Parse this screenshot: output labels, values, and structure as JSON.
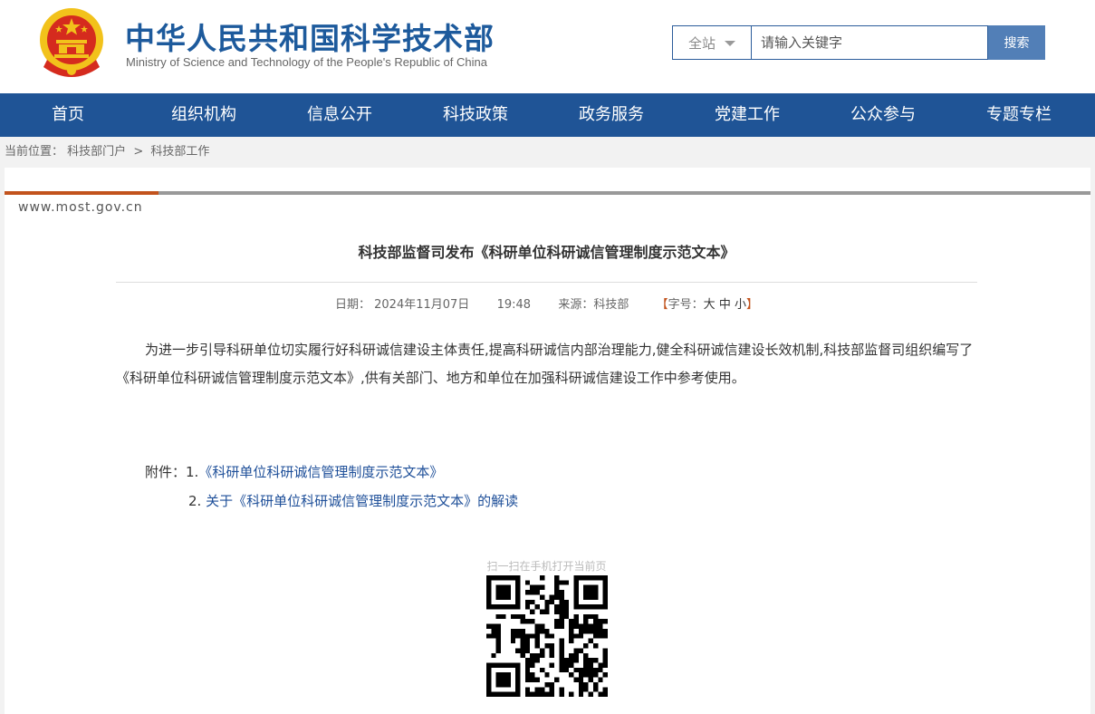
{
  "header": {
    "title": "中华人民共和国科学技术部",
    "subtitle": "Ministry of Science and Technology of the People's Republic of China",
    "emblem_icon": "national-emblem-icon"
  },
  "search": {
    "scope": "全站",
    "placeholder": "请输入关键字",
    "button_label": "搜索"
  },
  "nav": {
    "items": [
      "首页",
      "组织机构",
      "信息公开",
      "科技政策",
      "政务服务",
      "党建工作",
      "公众参与",
      "专题专栏"
    ]
  },
  "breadcrumb": {
    "label": "当前位置：",
    "items": [
      "科技部门户",
      "科技部工作"
    ],
    "separator": ">"
  },
  "article": {
    "domain": "www.most.gov.cn",
    "title": "科技部监督司发布《科研单位科研诚信管理制度示范文本》",
    "date_label": "日期：",
    "date": "2024年11月07日",
    "time": "19:48",
    "source_label": "来源：",
    "source": "科技部",
    "font_size_label": "字号：",
    "font_sizes": [
      "大",
      "中",
      "小"
    ],
    "body": "为进一步引导科研单位切实履行好科研诚信建设主体责任,提高科研诚信内部治理能力,健全科研诚信建设长效机制,科技部监督司组织编写了《科研单位科研诚信管理制度示范文本》,供有关部门、地方和单位在加强科研诚信建设工作中参考使用。",
    "attachments_label": "附件：",
    "attachments": [
      {
        "number": "1.",
        "text": "《科研单位科研诚信管理制度示范文本》"
      },
      {
        "number": "2.",
        "text": "关于《科研单位科研诚信管理制度示范文本》的解读"
      }
    ],
    "qr_caption": "扫一扫在手机打开当前页"
  },
  "colors": {
    "brand_blue": "#1d5a9c",
    "nav_bg": "#1f5496",
    "accent_orange": "#c2531d",
    "link": "#1e4f99",
    "emblem_red": "#d52b1e",
    "emblem_gold": "#f2c21b"
  }
}
